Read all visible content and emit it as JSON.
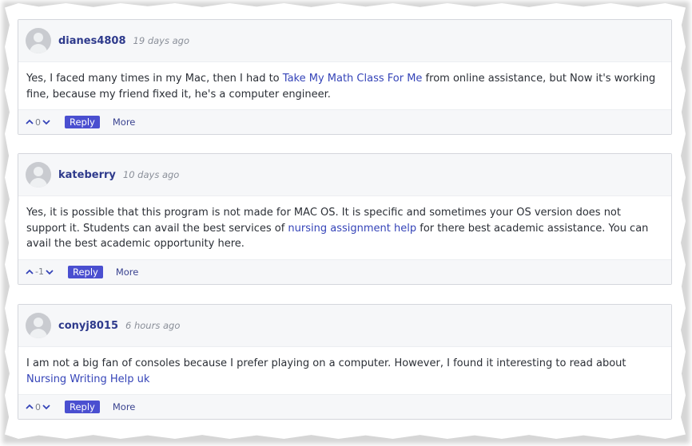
{
  "colors": {
    "username": "#2e3a8c",
    "link": "#3544b8",
    "reply_button": "#4a4fd0",
    "vote_arrow": "#3544b8"
  },
  "comments": [
    {
      "username": "dianes4808",
      "time": "19 days ago",
      "text_before": "Yes, I faced many times in my Mac, then I had to ",
      "link_text": "Take My Math Class For Me",
      "text_after": " from online assistance, but Now it's working fine, because my friend fixed it, he's a computer engineer.",
      "score": "0",
      "reply_label": "Reply",
      "more_label": "More"
    },
    {
      "username": "kateberry",
      "time": "10 days ago",
      "text_before": "Yes, it is possible that this program is not made for MAC OS. It is specific and sometimes your OS version does not support it. Students can avail the best services of ",
      "link_text": "nursing assignment help",
      "text_after": " for there best academic assistance. You can avail the best academic opportunity here.",
      "score": "-1",
      "reply_label": "Reply",
      "more_label": "More"
    },
    {
      "username": "conyj8015",
      "time": "6 hours ago",
      "text_before": "I am not a big fan of consoles because I prefer playing on a computer. However, I found it interesting to read about  ",
      "link_text": "Nursing Writing Help uk",
      "text_after": "",
      "score": "0",
      "reply_label": "Reply",
      "more_label": "More"
    }
  ]
}
